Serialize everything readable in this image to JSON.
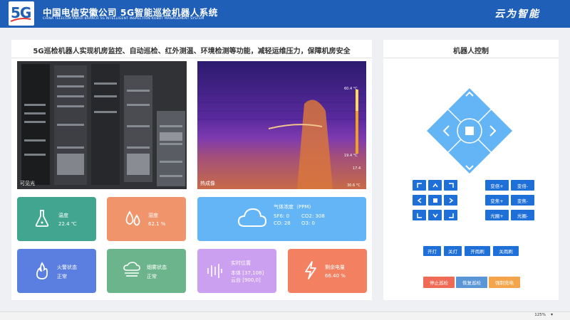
{
  "header": {
    "logo": "5G",
    "title": "中国电信安徽公司 5G智能巡检机器人系统",
    "subtitle": "CHINA TELECOM ANHUI BRANCH 5G INTELLIGENT INSPECTION ROBOT MANAGEMENT SYSTEM",
    "brand": "云为智能"
  },
  "main": {
    "title": "5G巡检机器人实现机房监控、自动巡检、红外测温、环境检测等功能，减轻运维压力，保障机房安全",
    "video_visible_label": "可见光",
    "video_thermal_label": "热成像"
  },
  "cards": {
    "temperature": {
      "label": "温度",
      "value": "22.4 ℃",
      "icon": "flask-icon"
    },
    "humidity": {
      "label": "湿度",
      "value": "62.1 %",
      "icon": "droplets-icon"
    },
    "gas": {
      "label": "气体浓度（PPM)",
      "sf6": "SF6: 0",
      "co2": "CO2: 308",
      "co": "CO: 28",
      "o3": "O3: 0",
      "icon": "cloud-icon"
    },
    "fire": {
      "label": "火警状态",
      "value": "正常",
      "icon": "flame-icon"
    },
    "smoke": {
      "label": "烟雾状态",
      "value": "正常",
      "icon": "fog-icon"
    },
    "position": {
      "label": "实时位置",
      "body": "本体 [37,108]",
      "gimbal": "云台 [900,0]",
      "icon": "signal-bars-icon"
    },
    "battery": {
      "label": "剩余电量",
      "value": "66.40 %",
      "icon": "lightning-icon"
    }
  },
  "control": {
    "title": "机器人控制",
    "camera": {
      "zoom_in": "变倍+",
      "zoom_out": "变倍-",
      "focus_in": "变焦+",
      "focus_out": "变焦-",
      "iris_in": "光圈+",
      "iris_out": "光圈-"
    },
    "actions": {
      "light_on": "开灯",
      "light_off": "关灯",
      "wiper_on": "开雨刷",
      "wiper_off": "关雨刷"
    },
    "patrol": {
      "stop": "停止巡检",
      "resume": "恢复巡检",
      "charge": "强制充电"
    }
  },
  "status_bar": {
    "zoom": "125%"
  },
  "colors": {
    "header": "#1f5fb8",
    "button_blue": "#1f6fd8",
    "dpad": "#64b5f6",
    "stop": "#f06b56",
    "resume": "#5a95d6",
    "charge": "#f4a44a"
  }
}
